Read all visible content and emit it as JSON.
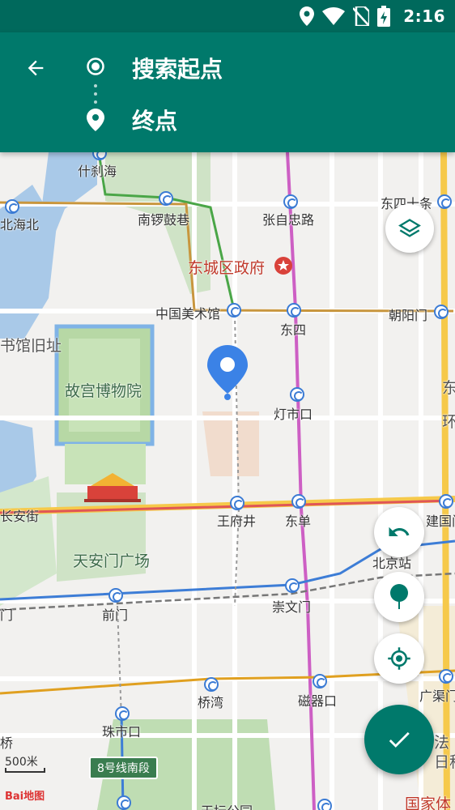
{
  "status_bar": {
    "time": "2:16"
  },
  "header": {
    "start_label": "搜索起点",
    "end_label": "终点"
  },
  "map": {
    "labels": {
      "shichahai": "什刹海",
      "beihaibei": "北海北",
      "nanluoguxiang": "南锣鼓巷",
      "zhangzizhonglu": "张自忠路",
      "dongsishitiao": "东四十条",
      "dongcheng_gov": "东城区政府",
      "library": "书馆旧址",
      "meishuguan": "中国美术馆",
      "dongsi": "东四",
      "chaoyangmen": "朝阳门",
      "gugong": "故宫博物院",
      "dengshikou": "灯市口",
      "dong_edge": "东",
      "huan_edge": "环",
      "changanjie": "长安街",
      "wangfujing": "王府井",
      "dongdan": "东单",
      "jianguomen": "建国门",
      "tiananmen_square": "天安门广场",
      "beijing_station": "北京站",
      "men_edge": "门",
      "qianmen": "前门",
      "chongwenmen": "崇文门",
      "qiaowan": "桥湾",
      "ciqikou": "磁器口",
      "guangqumen": "广渠门",
      "qiao_edge": "桥",
      "zhushikou": "珠市口",
      "fa_edge": "法",
      "ritan_edge": "日租",
      "tiantan": "天坛公园",
      "guojiati": "国家体"
    },
    "line8": "8号线南段",
    "scale": "500米",
    "logo": "Bai地图"
  },
  "colors": {
    "status_bar": "#00695c",
    "header": "#00796b",
    "accent": "#00796b",
    "pin": "#3b82e6"
  }
}
